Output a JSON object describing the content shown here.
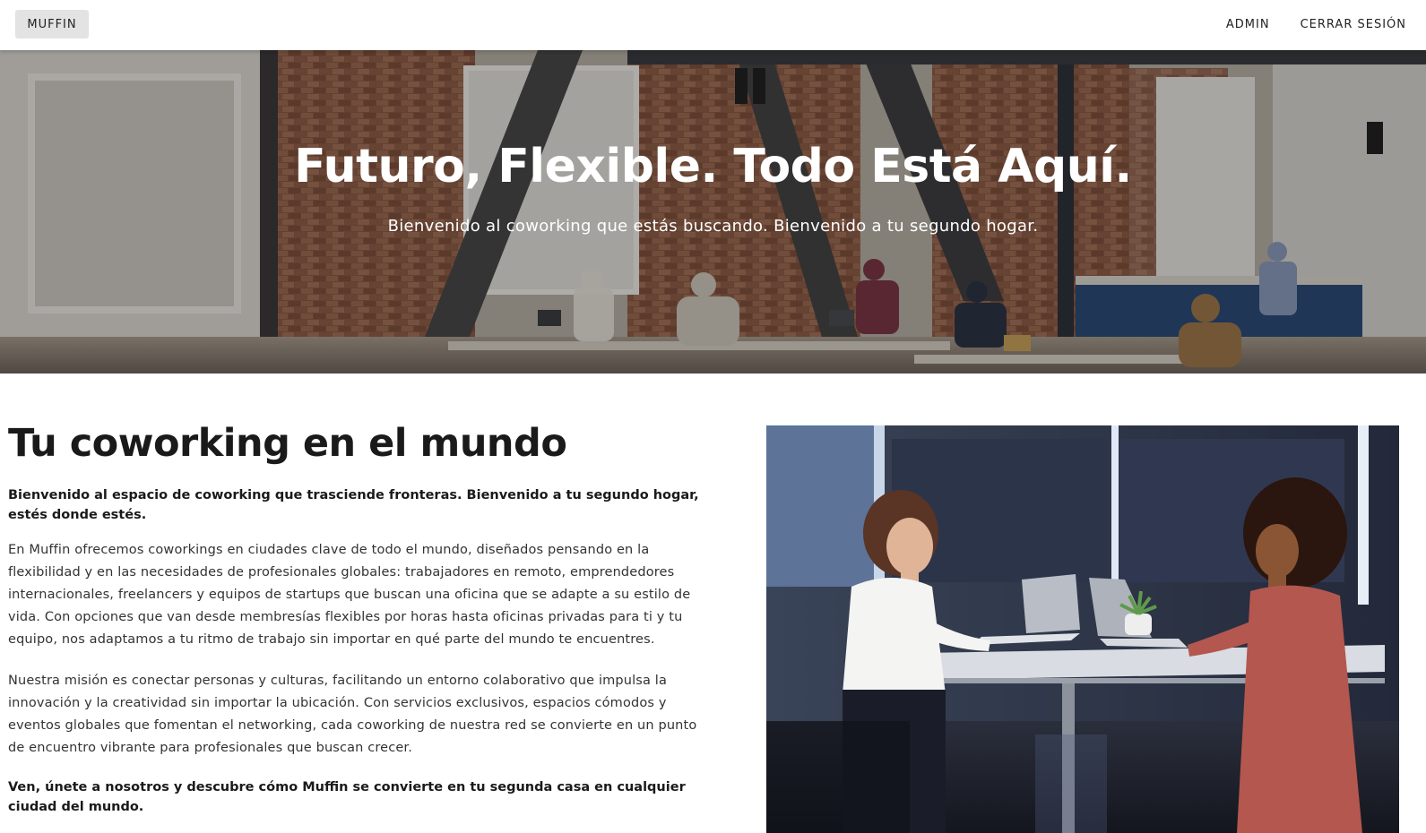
{
  "header": {
    "brand_label": "MUFFIN",
    "nav": [
      {
        "label": "ADMIN"
      },
      {
        "label": "CERRAR SESIÓN"
      }
    ]
  },
  "hero": {
    "title": "Futuro, Flexible. Todo Está Aquí.",
    "subtitle": "Bienvenido al coworking que estás buscando. Bienvenido a tu segundo hogar."
  },
  "main": {
    "heading": "Tu coworking en el mundo",
    "lead": "Bienvenido al espacio de coworking que trasciende fronteras. Bienvenido a tu segundo hogar, estés donde estés.",
    "paragraphs": [
      "En Muffin ofrecemos coworkings en ciudades clave de todo el mundo, diseñados pensando en la flexibilidad y en las necesidades de profesionales globales: trabajadores en remoto, emprendedores internacionales, freelancers y equipos de startups que buscan una oficina que se adapte a su estilo de vida. Con opciones que van desde membresías flexibles por horas hasta oficinas privadas para ti y tu equipo, nos adaptamos a tu ritmo de trabajo sin importar en qué parte del mundo te encuentres.",
      "Nuestra misión es conectar personas y culturas, facilitando un entorno colaborativo que impulsa la innovación y la creatividad sin importar la ubicación. Con servicios exclusivos, espacios cómodos y eventos globales que fomentan el networking, cada coworking de nuestra red se convierte en un punto de encuentro vibrante para profesionales que buscan crecer."
    ],
    "closing": "Ven, únete a nosotros y descubre cómo Muffin se convierte en tu segunda casa en cualquier ciudad del mundo."
  }
}
